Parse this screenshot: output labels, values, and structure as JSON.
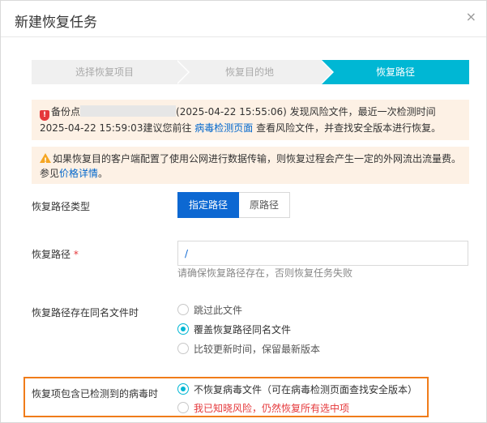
{
  "dialog": {
    "title": "新建恢复任务",
    "close_glyph": "×"
  },
  "steps": [
    {
      "label": "选择恢复项目",
      "state": "done"
    },
    {
      "label": "恢复目的地",
      "state": "done"
    },
    {
      "label": "恢复路径",
      "state": "active"
    }
  ],
  "risk_banner": {
    "icon": "shield-alert-icon",
    "prefix": "备份点",
    "text1": "(2025-04-22 15:55:06) 发现风险文件，最近一次检测时间 2025-04-22 15:59:03建议您前往 ",
    "link": "病毒检测页面",
    "text2": " 查看风险文件，并查找安全版本进行恢复。"
  },
  "network_banner": {
    "icon": "warning-triangle-icon",
    "text": "如果恢复目的客户端配置了使用公网进行数据传输，则恢复过程会产生一定的外网流出流量费。 参见",
    "link": "价格详情",
    "suffix": "。"
  },
  "form": {
    "path_type": {
      "label": "恢复路径类型",
      "options": [
        "指定路径",
        "原路径"
      ],
      "selected": "指定路径"
    },
    "path": {
      "label": "恢复路径",
      "required_mark": "*",
      "value": "/",
      "hint": "请确保恢复路径存在，否则恢复任务失败"
    },
    "same_name": {
      "label": "恢复路径存在同名文件时",
      "options": [
        "跳过此文件",
        "覆盖恢复路径同名文件",
        "比较更新时间，保留最新版本"
      ],
      "selected": "覆盖恢复路径同名文件"
    },
    "virus": {
      "label": "恢复项包含已检测到的病毒时",
      "options": [
        "不恢复病毒文件（可在病毒检测页面查找安全版本）",
        "我已知晓风险，仍然恢复所有选中项"
      ],
      "selected": "不恢复病毒文件（可在病毒检测页面查找安全版本）"
    }
  },
  "colors": {
    "accent": "#00b7d4",
    "primary": "#0d68d2",
    "danger": "#e5383b",
    "highlight": "#f07c1a",
    "banner_bg": "#fdf1e5"
  }
}
